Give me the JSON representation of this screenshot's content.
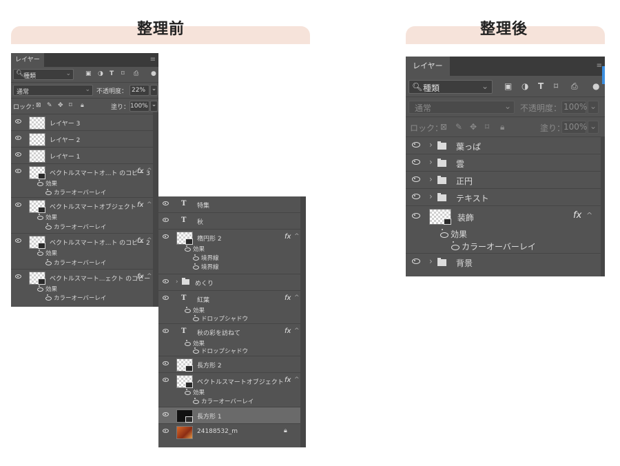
{
  "before": {
    "heading": "整理前",
    "panel": {
      "tab": "レイヤー",
      "search": "種類",
      "blend": "通常",
      "opacity_label": "不透明度：",
      "opacity": "22%",
      "lock_label": "ロック：",
      "fill_label": "塗り：",
      "fill": "100%",
      "layers": [
        {
          "name": "レイヤー 3"
        },
        {
          "name": "レイヤー 2"
        },
        {
          "name": "レイヤー 1"
        },
        {
          "name": "ベクトルスマートオ...ト のコピー 3",
          "effects": "効果",
          "effect": "カラーオーバーレイ"
        },
        {
          "name": "ベクトルスマートオブジェクト",
          "effects": "効果",
          "effect": "カラーオーバーレイ"
        },
        {
          "name": "ベクトルスマートオ...ト のコピー 2",
          "effects": "効果",
          "effect": "カラーオーバーレイ"
        },
        {
          "name": "ベクトルスマート...ェクト のコピー",
          "effects": "効果",
          "effect": "カラーオーバーレイ"
        }
      ]
    },
    "continued": {
      "layers": [
        {
          "name": "特集"
        },
        {
          "name": "秋"
        },
        {
          "name": "楕円形 2",
          "effects": "効果",
          "effect1": "境界線",
          "effect2": "境界線"
        },
        {
          "name": "めくり"
        },
        {
          "name": "紅葉",
          "effects": "効果",
          "effect": "ドロップシャドウ"
        },
        {
          "name": "秋の彩を訪ねて",
          "effects": "効果",
          "effect": "ドロップシャドウ"
        },
        {
          "name": "長方形 2"
        },
        {
          "name": "ベクトルスマートオブジェクト",
          "effects": "効果",
          "effect": "カラーオーバーレイ"
        },
        {
          "name": "長方形 1"
        },
        {
          "name": "24188532_m"
        }
      ]
    }
  },
  "after": {
    "heading": "整理後",
    "panel": {
      "tab": "レイヤー",
      "search": "種類",
      "blend": "通常",
      "opacity_label": "不透明度：",
      "opacity": "100%",
      "lock_label": "ロック：",
      "fill_label": "塗り：",
      "fill": "100%",
      "layers": [
        {
          "name": "葉っぱ"
        },
        {
          "name": "雲"
        },
        {
          "name": "正円"
        },
        {
          "name": "テキスト"
        },
        {
          "name": "装飾",
          "effects": "効果",
          "effect": "カラーオーバーレイ"
        },
        {
          "name": "背景"
        }
      ]
    }
  },
  "fx_label": "fx"
}
